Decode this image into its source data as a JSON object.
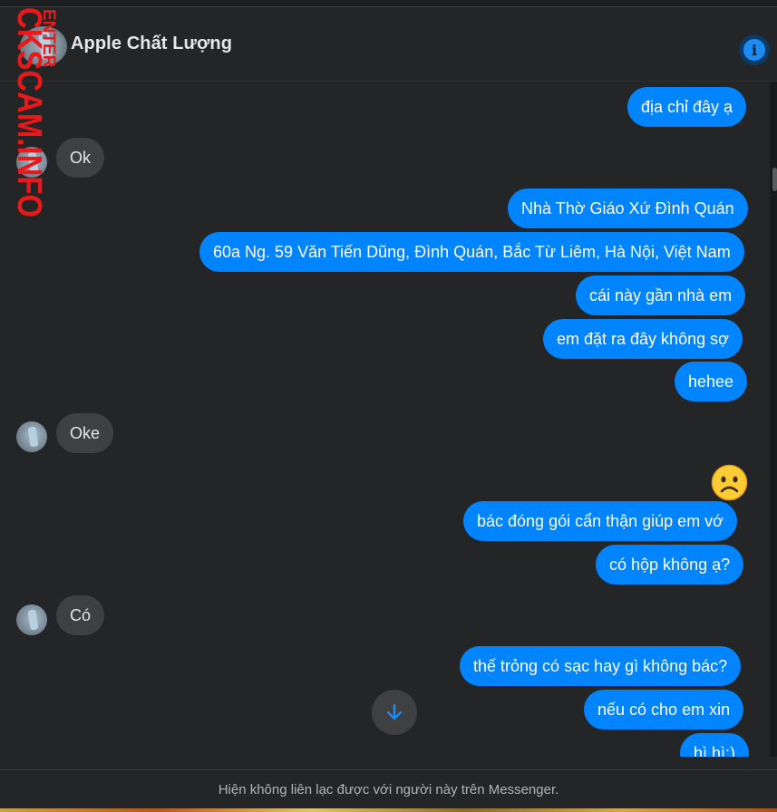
{
  "header": {
    "contact_name": "Apple Chất Lượng",
    "info_icon": "info-icon"
  },
  "watermark": {
    "main_text": "CKSCAM.INFO",
    "top_text": "ENTER"
  },
  "messages": [
    {
      "side": "out",
      "text": "địa chỉ đây ạ"
    },
    {
      "side": "in",
      "text": "Ok"
    },
    {
      "side": "out",
      "text": "Nhà Thờ Giáo Xứ Đình Quán"
    },
    {
      "side": "out",
      "text": "60a Ng. 59 Văn Tiến Dũng, Đình Quán, Bắc Từ Liêm, Hà Nội, Việt Nam"
    },
    {
      "side": "out",
      "text": "cái này gần nhà em"
    },
    {
      "side": "out",
      "text": "em đặt ra đây không sợ"
    },
    {
      "side": "out",
      "text": "hehee"
    },
    {
      "side": "in",
      "text": "Oke"
    },
    {
      "side": "out",
      "emoji": "frowning-face"
    },
    {
      "side": "out",
      "text": "bác đóng gói cẩn thận giúp em vớ"
    },
    {
      "side": "out",
      "text": "có hộp không ạ?"
    },
    {
      "side": "in",
      "text": "Có"
    },
    {
      "side": "out",
      "text": "thế trỏng có sạc hay gì không bác?"
    },
    {
      "side": "out",
      "text": "nếu có cho em xin"
    },
    {
      "side": "out",
      "text": "hì hì:)"
    }
  ],
  "scroll_button_icon": "arrow-down-icon",
  "footer": {
    "notice": "Hiện không liên lạc được với người này trên Messenger."
  },
  "colors": {
    "outgoing_bubble": "#0084ff",
    "incoming_bubble": "#3e4042",
    "background": "#242526",
    "watermark": "#e8191a"
  }
}
